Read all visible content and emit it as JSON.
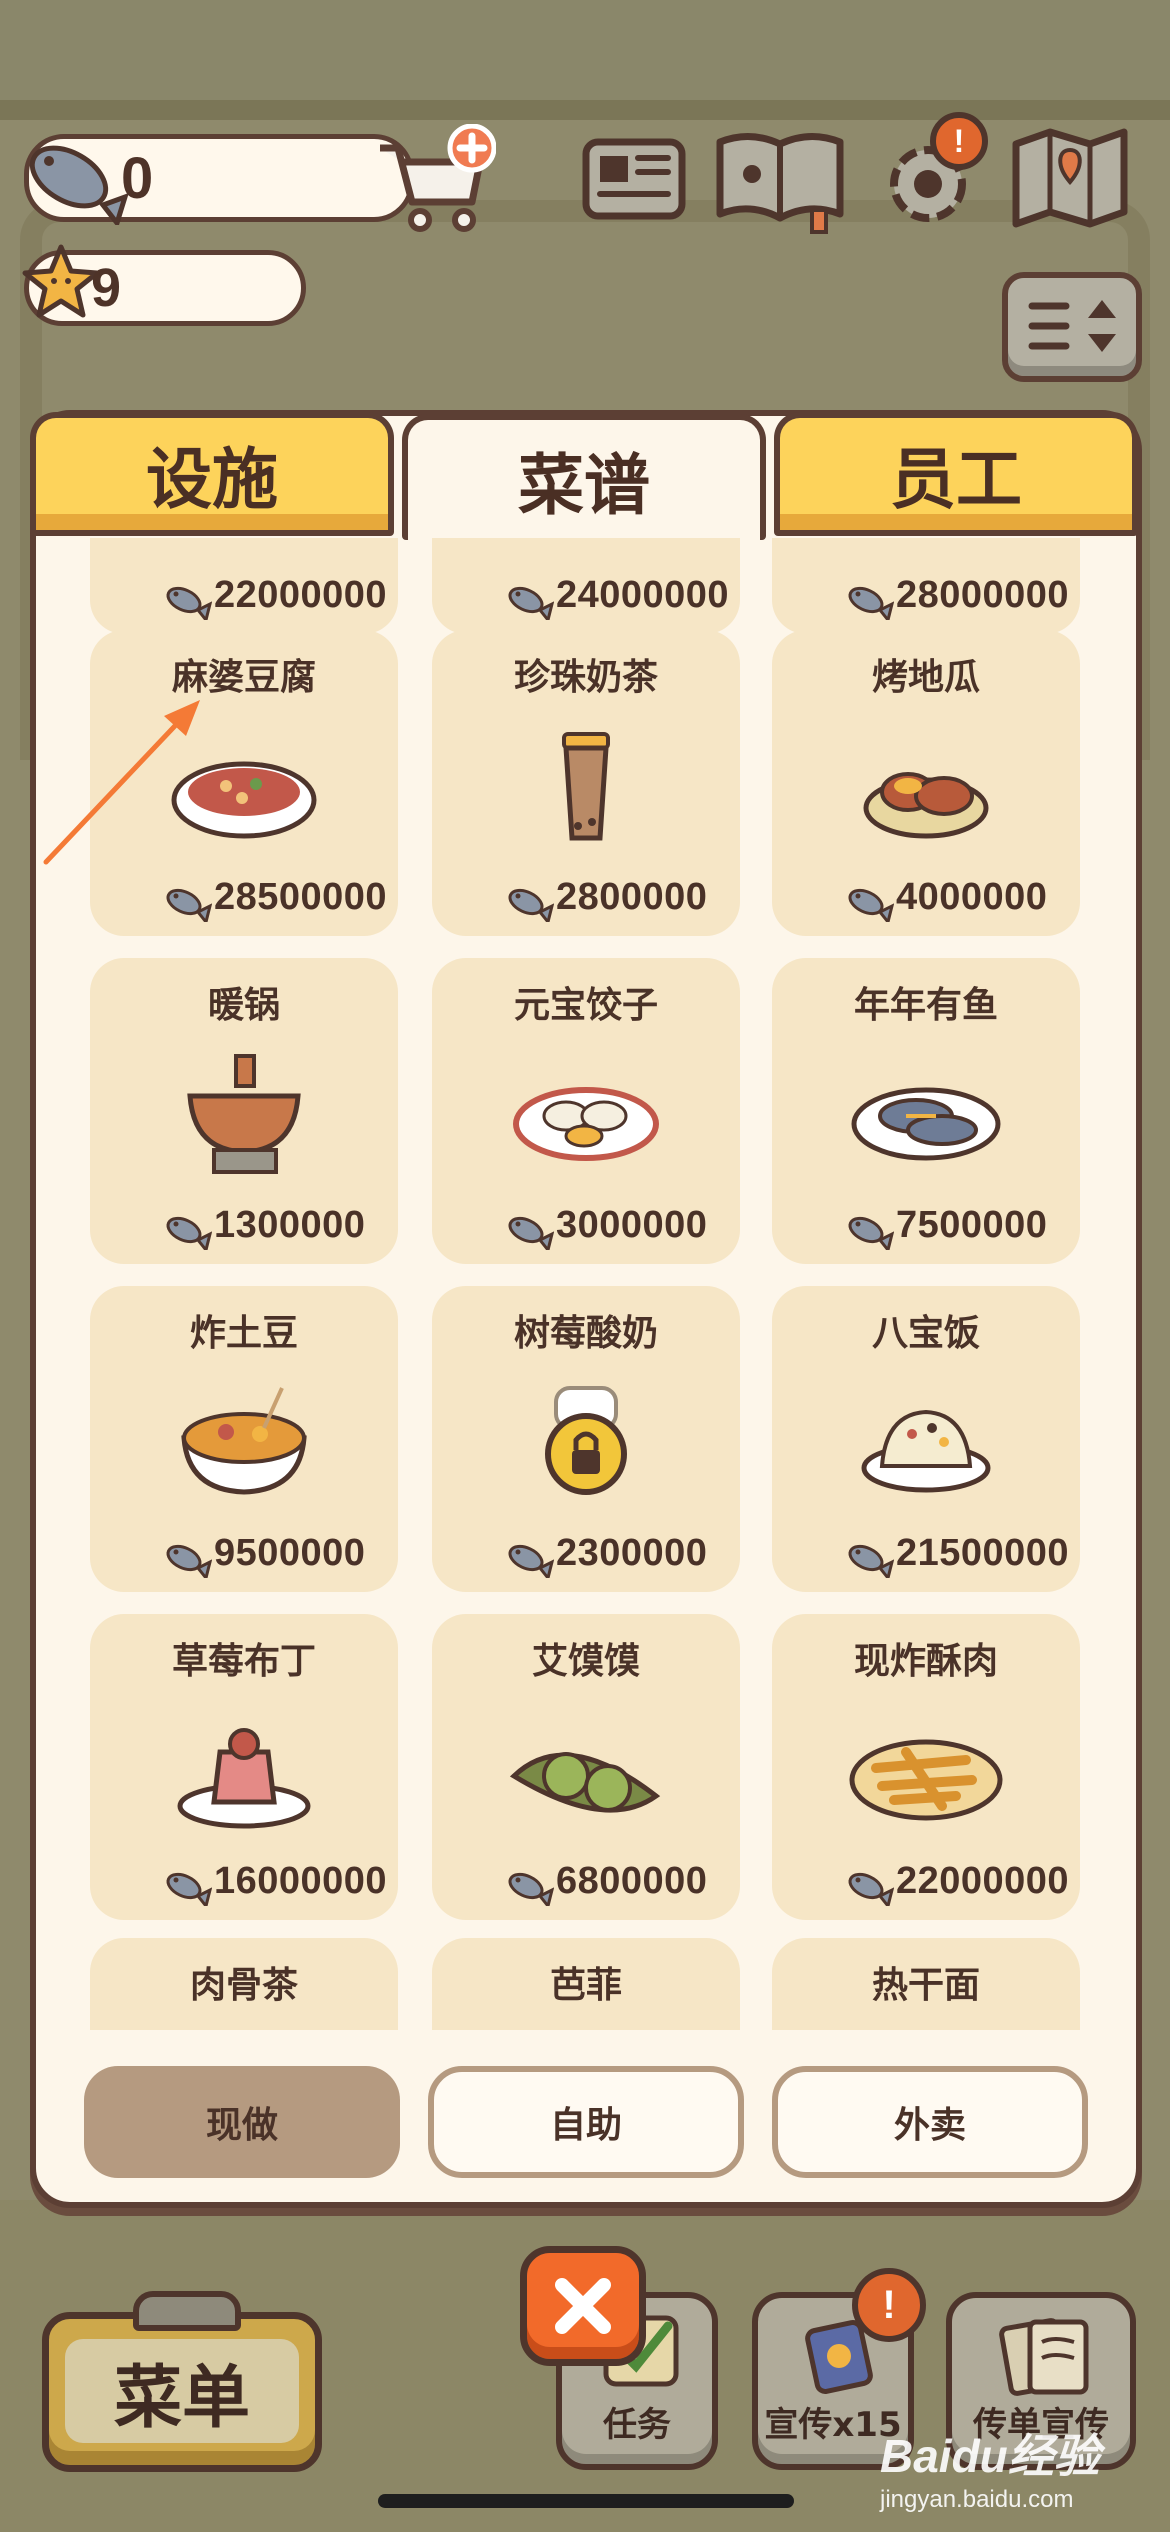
{
  "header": {
    "fish_count": "0",
    "star_count": "9"
  },
  "tabs": [
    {
      "label": "设施",
      "active": false
    },
    {
      "label": "菜谱",
      "active": true
    },
    {
      "label": "员工",
      "active": false
    }
  ],
  "recipes": [
    {
      "name": "",
      "price": "22000000",
      "icon": "dish-partial"
    },
    {
      "name": "",
      "price": "24000000",
      "icon": "dish-partial"
    },
    {
      "name": "",
      "price": "28000000",
      "icon": "dish-partial"
    },
    {
      "name": "麻婆豆腐",
      "price": "28500000",
      "icon": "mapo-tofu"
    },
    {
      "name": "珍珠奶茶",
      "price": "2800000",
      "icon": "bubble-tea"
    },
    {
      "name": "烤地瓜",
      "price": "4000000",
      "icon": "sweet-potato"
    },
    {
      "name": "暖锅",
      "price": "1300000",
      "icon": "hot-pot"
    },
    {
      "name": "元宝饺子",
      "price": "3000000",
      "icon": "dumplings"
    },
    {
      "name": "年年有鱼",
      "price": "7500000",
      "icon": "fish-dish"
    },
    {
      "name": "炸土豆",
      "price": "9500000",
      "icon": "fried-potato"
    },
    {
      "name": "树莓酸奶",
      "price": "2300000",
      "icon": "locked"
    },
    {
      "name": "八宝饭",
      "price": "21500000",
      "icon": "eight-treasure-rice"
    },
    {
      "name": "草莓布丁",
      "price": "16000000",
      "icon": "strawberry-pudding"
    },
    {
      "name": "艾馍馍",
      "price": "6800000",
      "icon": "mugwort-bun"
    },
    {
      "name": "现炸酥肉",
      "price": "22000000",
      "icon": "crispy-pork"
    },
    {
      "name": "肉骨茶",
      "price": "",
      "icon": "dish-partial"
    },
    {
      "name": "芭菲",
      "price": "",
      "icon": "dish-partial"
    },
    {
      "name": "热干面",
      "price": "",
      "icon": "dish-partial"
    }
  ],
  "filters": [
    {
      "label": "现做",
      "selected": true
    },
    {
      "label": "自助",
      "selected": false
    },
    {
      "label": "外卖",
      "selected": false
    }
  ],
  "bottom_bar": {
    "menu_label": "菜单",
    "tasks_label": "任务",
    "promote_label": "宣传x15",
    "flyer_label": "传单宣传"
  },
  "alerts": {
    "settings_badge": "!",
    "promote_badge": "!"
  },
  "watermark": {
    "logo": "Baidu经验",
    "url": "jingyan.baidu.com"
  },
  "colors": {
    "tab_yellow": "#fdd35b",
    "card_bg": "#f6e6c6",
    "panel_bg": "#fdf6ea",
    "outline": "#5c3f34",
    "arrow": "#f47a36",
    "close": "#f26a2a"
  }
}
